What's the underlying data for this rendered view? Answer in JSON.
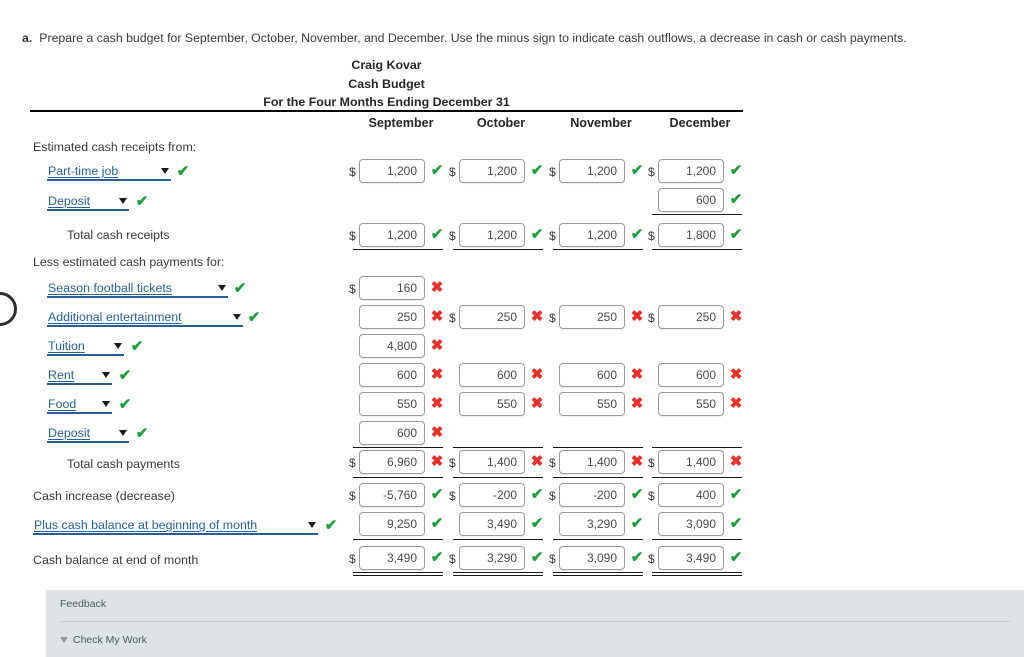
{
  "prompt": {
    "letter": "a.",
    "text": "Prepare a cash budget for September, October, November, and December. Use the minus sign to indicate cash outflows, a decrease in cash or cash payments."
  },
  "statement": {
    "company": "Craig Kovar",
    "title": "Cash Budget",
    "period": "For the Four Months Ending December 31"
  },
  "columns": [
    "September",
    "October",
    "November",
    "December"
  ],
  "labels": {
    "receipts_header": "Estimated cash receipts from:",
    "total_receipts": "Total cash receipts",
    "payments_header": "Less estimated cash payments for:",
    "total_payments": "Total cash payments",
    "cash_increase": "Cash increase (decrease)",
    "cash_end": "Cash balance at end of month"
  },
  "selects": {
    "part_time_job": "Part-time job",
    "deposit_receipt": "Deposit",
    "season_football": "Season football tickets",
    "additional_entertainment": "Additional entertainment",
    "tuition": "Tuition",
    "rent": "Rent",
    "food": "Food",
    "deposit_payment": "Deposit",
    "plus_cash_balance": "Plus cash balance at beginning of month"
  },
  "symbols": {
    "dollar": "$",
    "check": "✔",
    "cross": "✖"
  },
  "rows": {
    "part_time_job": {
      "sep": "1,200",
      "oct": "1,200",
      "nov": "1,200",
      "dec": "1,200"
    },
    "deposit_receipt": {
      "sep": "",
      "oct": "",
      "nov": "",
      "dec": "600"
    },
    "total_receipts": {
      "sep": "1,200",
      "oct": "1,200",
      "nov": "1,200",
      "dec": "1,800"
    },
    "season_football": {
      "sep": "160",
      "oct": "",
      "nov": "",
      "dec": ""
    },
    "additional_entertainment": {
      "sep": "250",
      "oct": "250",
      "nov": "250",
      "dec": "250"
    },
    "tuition": {
      "sep": "4,800",
      "oct": "",
      "nov": "",
      "dec": ""
    },
    "rent": {
      "sep": "600",
      "oct": "600",
      "nov": "600",
      "dec": "600"
    },
    "food": {
      "sep": "550",
      "oct": "550",
      "nov": "550",
      "dec": "550"
    },
    "deposit_payment": {
      "sep": "600",
      "oct": "",
      "nov": "",
      "dec": ""
    },
    "total_payments": {
      "sep": "6,960",
      "oct": "1,400",
      "nov": "1,400",
      "dec": "1,400"
    },
    "cash_increase": {
      "sep": "-5,760",
      "oct": "-200",
      "nov": "-200",
      "dec": "400"
    },
    "plus_cash_balance": {
      "sep": "9,250",
      "oct": "3,490",
      "nov": "3,290",
      "dec": "3,090"
    },
    "cash_end": {
      "sep": "3,490",
      "oct": "3,290",
      "nov": "3,090",
      "dec": "3,490"
    }
  },
  "feedback": {
    "title": "Feedback",
    "check_my_work": "Check My Work"
  },
  "colors": {
    "correct": "#1e9e3e",
    "incorrect": "#e8302b",
    "link": "#2a6099",
    "feedback_bg": "#dde3e6"
  }
}
